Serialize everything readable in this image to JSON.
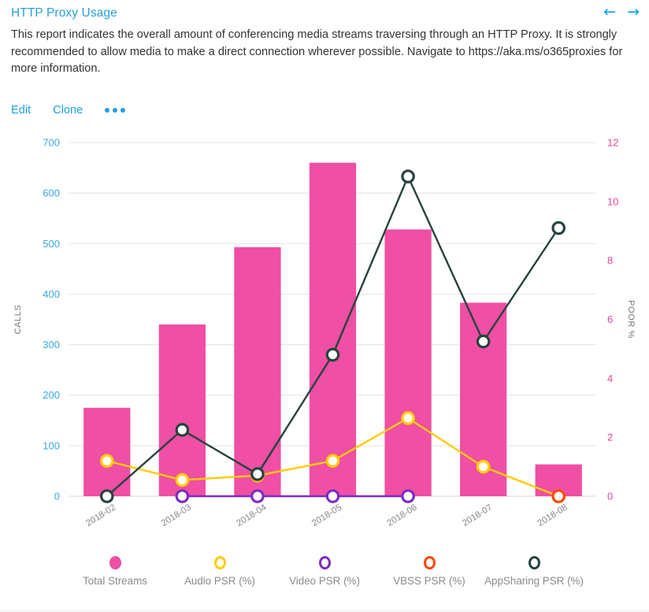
{
  "header": {
    "title": "HTTP Proxy Usage",
    "description": "This report indicates the overall amount of conferencing media streams traversing through an HTTP Proxy. It is strongly recommended to allow media to make a direct connection wherever possible. Navigate to https://aka.ms/o365proxies for more information.",
    "prev_arrow": "←",
    "next_arrow": "→"
  },
  "actions": {
    "edit_label": "Edit",
    "clone_label": "Clone",
    "more_label": "•••"
  },
  "colors": {
    "title_blue": "#2a9fd8",
    "link_blue": "#1ba1e2",
    "bar_pink": "#ef4fa4",
    "left_tick": "#3aa9e0",
    "right_tick": "#e8469b",
    "audio_yellow": "#ffcc00",
    "video_purple": "#7c2bc4",
    "vbss_orange": "#ff4500",
    "appsharing_dark": "#27423f",
    "grid": "#e3e3e3"
  },
  "chart_data": {
    "type": "bar",
    "title": "",
    "xlabel": "",
    "ylabel": "CALLS",
    "y2label": "POOR %",
    "categories": [
      "2018-02",
      "2018-03",
      "2018-04",
      "2018-05",
      "2018-06",
      "2018-07",
      "2018-08"
    ],
    "ylim": [
      0,
      700
    ],
    "yticks": [
      0,
      100,
      200,
      300,
      400,
      500,
      600,
      700
    ],
    "y2lim": [
      0,
      12
    ],
    "y2ticks": [
      0,
      2,
      4,
      6,
      8,
      10,
      12
    ],
    "grid": true,
    "legend_position": "bottom",
    "series": [
      {
        "name": "Total Streams",
        "type": "bar",
        "axis": "left",
        "color": "#ef4fa4",
        "marker": "filled-circle",
        "values": [
          175,
          340,
          493,
          660,
          528,
          383,
          63
        ]
      },
      {
        "name": "Audio PSR (%)",
        "type": "line",
        "axis": "right",
        "color": "#ffcc00",
        "marker": "open-circle",
        "values": [
          1.2,
          0.55,
          0.7,
          1.2,
          2.65,
          1.0,
          0
        ]
      },
      {
        "name": "Video PSR (%)",
        "type": "line",
        "axis": "right",
        "color": "#7c2bc4",
        "marker": "open-circle",
        "values": [
          null,
          0,
          0,
          0,
          0,
          null,
          null
        ]
      },
      {
        "name": "VBSS PSR (%)",
        "type": "line",
        "axis": "right",
        "color": "#ff4500",
        "marker": "open-circle",
        "values": [
          null,
          null,
          null,
          null,
          null,
          null,
          0
        ]
      },
      {
        "name": "AppSharing PSR (%)",
        "type": "line",
        "axis": "right",
        "color": "#27423f",
        "marker": "open-circle",
        "values": [
          0,
          2.25,
          0.75,
          4.8,
          10.85,
          5.25,
          9.1
        ]
      }
    ]
  },
  "legend": [
    {
      "label": "Total Streams",
      "color": "#ef4fa4",
      "filled": true
    },
    {
      "label": "Audio PSR (%)",
      "color": "#ffcc00",
      "filled": false
    },
    {
      "label": "Video PSR (%)",
      "color": "#7c2bc4",
      "filled": false
    },
    {
      "label": "VBSS PSR (%)",
      "color": "#ff4500",
      "filled": false
    },
    {
      "label": "AppSharing PSR (%)",
      "color": "#27423f",
      "filled": false
    }
  ]
}
